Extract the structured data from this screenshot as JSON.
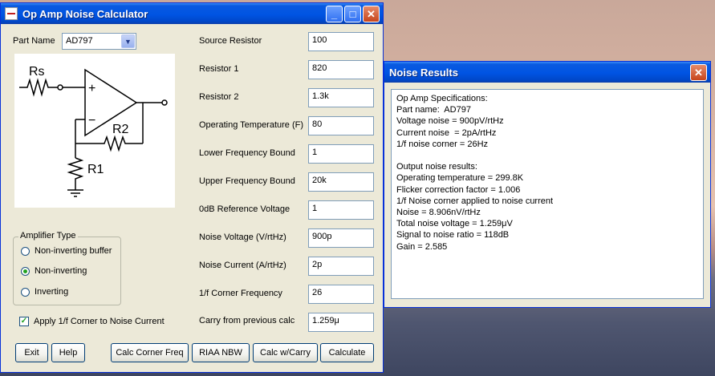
{
  "main_window": {
    "title": "Op Amp Noise Calculator",
    "part_name_label": "Part Name",
    "part_name_value": "AD797",
    "schematic": {
      "rs": "Rs",
      "r1": "R1",
      "r2": "R2",
      "plus": "+",
      "minus": "−"
    },
    "amplifier_type": {
      "legend": "Amplifier Type",
      "options": [
        "Non-inverting buffer",
        "Non-inverting",
        "Inverting"
      ],
      "selected": "Non-inverting"
    },
    "apply_corner_label": "Apply 1/f Corner to Noise Current",
    "apply_corner_checked": "✓",
    "fields": [
      {
        "label": "Source Resistor",
        "value": "100"
      },
      {
        "label": "Resistor 1",
        "value": "820"
      },
      {
        "label": "Resistor 2",
        "value": "1.3k"
      },
      {
        "label": "Operating Temperature (F)",
        "value": "80"
      },
      {
        "label": "Lower Frequency Bound",
        "value": "1"
      },
      {
        "label": "Upper Frequency Bound",
        "value": "20k"
      },
      {
        "label": "0dB Reference Voltage",
        "value": "1"
      },
      {
        "label": "Noise Voltage (V/rtHz)",
        "value": "900p"
      },
      {
        "label": "Noise Current (A/rtHz)",
        "value": "2p"
      },
      {
        "label": "1/f Corner Frequency",
        "value": "26"
      },
      {
        "label": "Carry from previous calc",
        "value": "1.259μ"
      }
    ],
    "buttons": {
      "exit": "Exit",
      "help": "Help",
      "calc_corner": "Calc Corner Freq",
      "riaa": "RIAA NBW",
      "calc_carry": "Calc w/Carry",
      "calculate": "Calculate"
    }
  },
  "results_window": {
    "title": "Noise Results",
    "lines": [
      "Op Amp Specifications:",
      "Part name:  AD797",
      "Voltage noise = 900pV/rtHz",
      "Current noise  = 2pA/rtHz",
      "1/f noise corner = 26Hz",
      "",
      "Output noise results:",
      "Operating temperature = 299.8K",
      "Flicker correction factor = 1.006",
      "1/f Noise corner applied to noise current",
      "Noise = 8.906nV/rtHz",
      "Total noise voltage = 1.259μV",
      "Signal to noise ratio = 118dB",
      "Gain = 2.585"
    ]
  },
  "titlebar_icons": {
    "minimize": "_",
    "maximize": "□",
    "close": "✕"
  }
}
